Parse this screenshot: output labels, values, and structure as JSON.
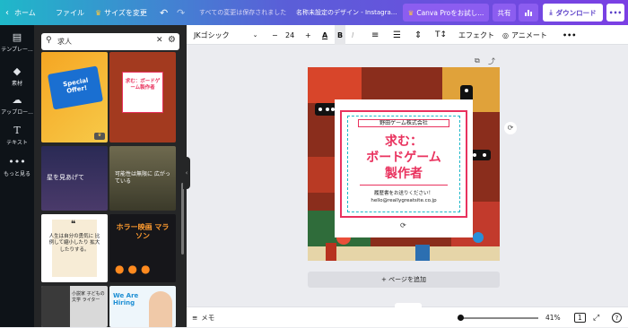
{
  "topbar": {
    "home": "ホーム",
    "file": "ファイル",
    "resize": "サイズを変更",
    "save_status": "すべての変更は保存されました",
    "doc_title": "名称未設定のデザイン - Instagra...",
    "pro_label": "Canva Proをお試し...",
    "share": "共有",
    "download": "ダウンロード"
  },
  "rail": {
    "items": [
      {
        "label": "テンプレー..."
      },
      {
        "label": "素材"
      },
      {
        "label": "アップロー..."
      },
      {
        "label": "テキスト"
      },
      {
        "label": "もっと見る"
      }
    ]
  },
  "search": {
    "value": "求人"
  },
  "templates": [
    {
      "text": "Special Offer!"
    },
    {
      "text": "求む：ボードゲーム製作者"
    },
    {
      "text": "星を見あげて"
    },
    {
      "text": "可能性は無限に 広がっている"
    },
    {
      "text": "人生は自分の勇気に 比例して縮小したり 拡大したりする。"
    },
    {
      "text": "ホラー映画 マラソン"
    },
    {
      "text": "小説家 子どもの文学 ライター"
    },
    {
      "text": "We Are Hiring"
    }
  ],
  "toolbar": {
    "font": "JKゴシック",
    "size": "24",
    "effects": "エフェクト",
    "animate": "アニメート"
  },
  "design": {
    "company": "野田ゲーム株式会社",
    "headline1": "求む：",
    "headline2": "ボードゲーム",
    "headline3": "製作者",
    "note": "履歴書をお送りください！",
    "email": "hello@reallygreatsite.co.jp"
  },
  "add_page": "+ ページを追加",
  "status": {
    "notes": "メモ",
    "zoom": "41%",
    "page_count": "1"
  },
  "colors": {
    "accent": "#e9325e",
    "teal": "#1fb8c9",
    "purple": "#7b3fe4",
    "panel_bg": "#252627"
  }
}
